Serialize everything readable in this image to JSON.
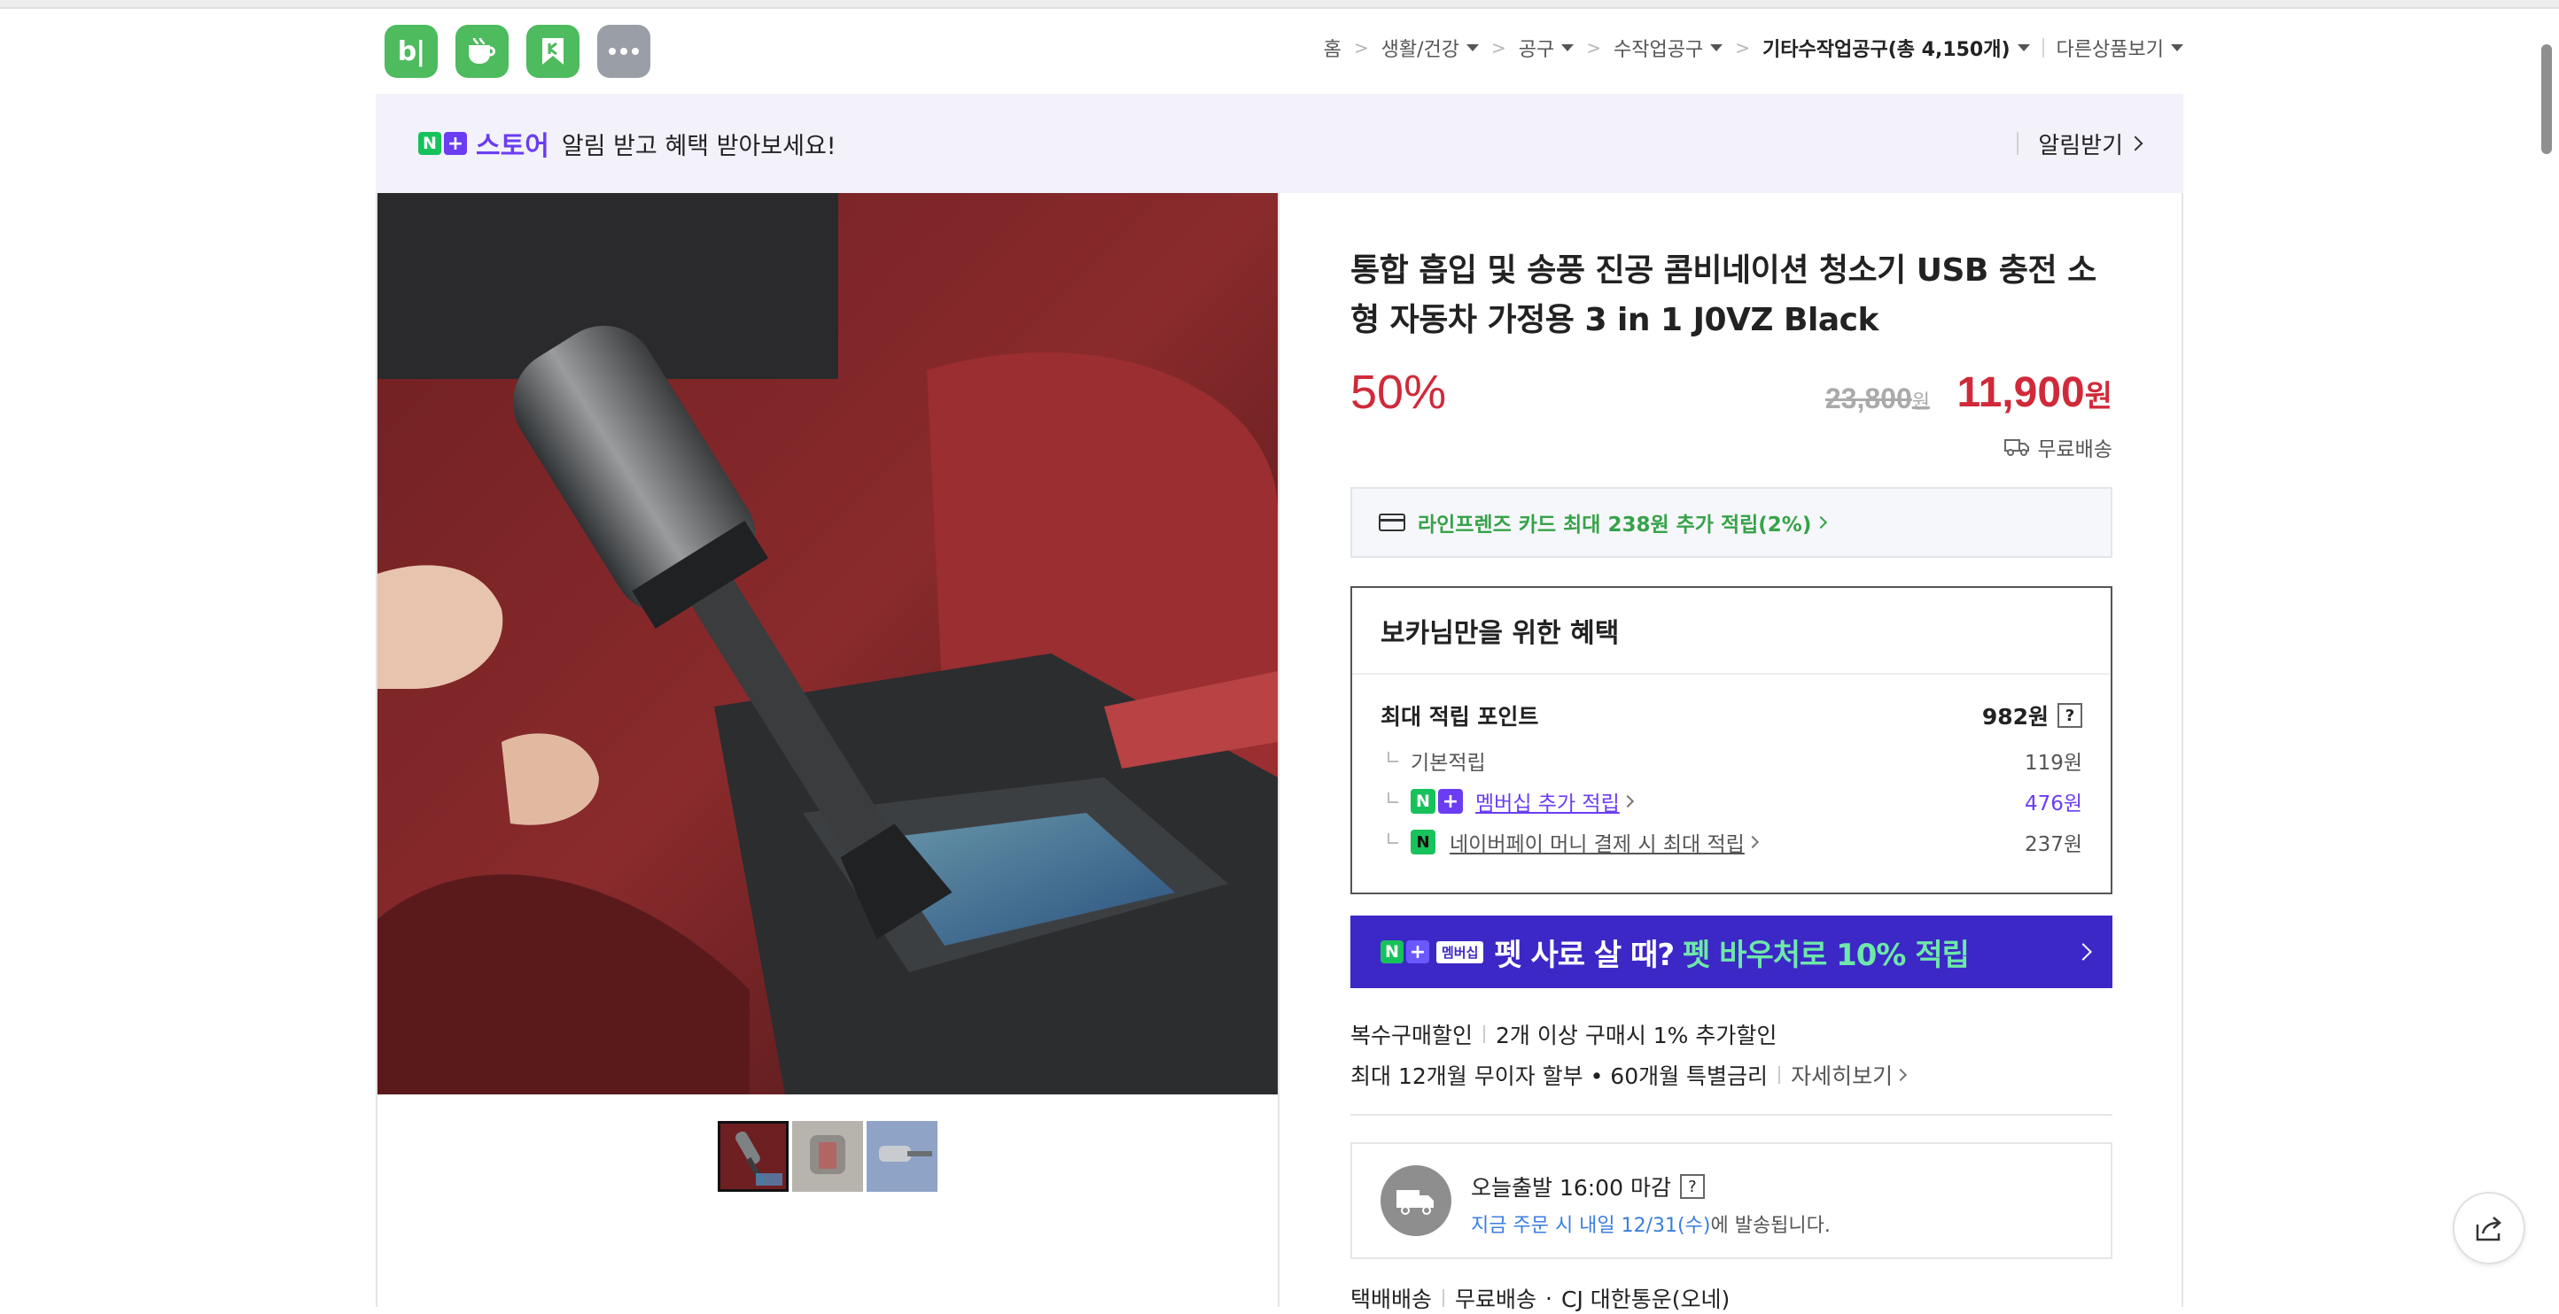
{
  "apps": {
    "blog_text": "b|",
    "icons": [
      "blog-icon",
      "cafe-icon",
      "band-icon",
      "more-icon"
    ]
  },
  "breadcrumb": {
    "items": [
      {
        "label": "홈",
        "dropdown": false
      },
      {
        "label": "생활/건강",
        "dropdown": true
      },
      {
        "label": "공구",
        "dropdown": true
      },
      {
        "label": "수작업공구",
        "dropdown": true
      }
    ],
    "current": {
      "label": "기타수작업공구",
      "count": "(총 4,150개)"
    },
    "other": "다른상품보기"
  },
  "notice": {
    "n": "N",
    "plus": "+",
    "store": "스토어",
    "message": "알림 받고 혜택 받아보세요!",
    "action": "알림받기"
  },
  "product": {
    "title": "통합 흡입 및 송풍 진공 콤비네이션 청소기 USB 충전 소형 자동차 가정용 3 in 1 J0VZ Black",
    "discount": "50%",
    "original_price": "23,800",
    "original_unit": "원",
    "sale_price": "11,900",
    "sale_unit": "원",
    "shipping": "무료배송"
  },
  "card_benefit": {
    "text": "라인프렌즈 카드 최대 238원 추가 적립(2%)"
  },
  "benefit": {
    "heading": "보카님만을 위한 혜택",
    "max_label": "최대 적립 포인트",
    "max_value": "982원",
    "q": "?",
    "basic_label": "기본적립",
    "basic_value": "119원",
    "membership_label": "멤버십 추가 적립",
    "membership_value": "476원",
    "npay_label": "네이버페이 머니 결제 시 최대 적립",
    "npay_value": "237원",
    "npay_symbol": "N"
  },
  "membership_banner": {
    "tag": "멤버십",
    "text": "펫 사료 살 때?",
    "highlight": "펫 바우처로 10% 적립"
  },
  "discounts": {
    "multi_label": "복수구매할인",
    "multi_value": "2개 이상 구매시 1% 추가할인",
    "installment": "최대 12개월 무이자 할부 • 60개월 특별금리",
    "detail": "자세히보기"
  },
  "dispatch": {
    "title": "오늘출발 16:00 마감",
    "q": "?",
    "sub_highlight": "지금 주문 시 내일 12/31(수)",
    "sub_rest": "에 발송됩니다."
  },
  "delivery": {
    "label": "택배배송",
    "value": "무료배송",
    "carrier": "CJ 대한통운(오네)"
  },
  "colors": {
    "accent_red": "#d02a3a",
    "naver_green": "#18c25b",
    "plus_purple": "#6a3df2",
    "membership_blue": "#3c28c7",
    "card_green": "#37a24a"
  }
}
